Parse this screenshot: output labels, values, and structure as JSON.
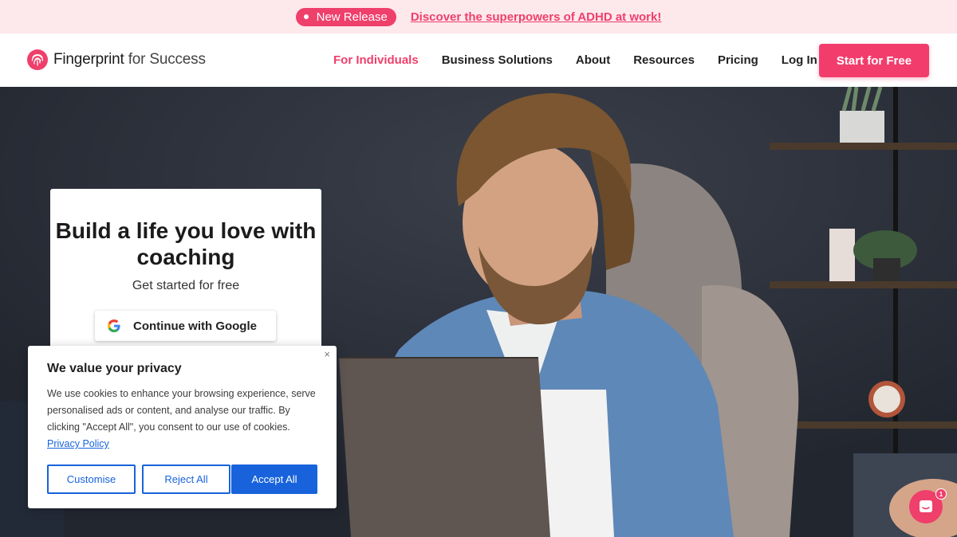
{
  "announcement": {
    "pill_label": "New Release",
    "link_text": "Discover the superpowers of ADHD at work!"
  },
  "header": {
    "logo_brand": "Fingerprint",
    "logo_suffix": " for Success",
    "nav": [
      {
        "label": "For Individuals",
        "active": true
      },
      {
        "label": "Business Solutions",
        "active": false
      },
      {
        "label": "About",
        "active": false
      },
      {
        "label": "Resources",
        "active": false
      },
      {
        "label": "Pricing",
        "active": false
      },
      {
        "label": "Log In",
        "active": false
      }
    ],
    "cta_label": "Start for Free"
  },
  "hero": {
    "title": "Build a life you love with coaching",
    "subtitle": "Get started for free",
    "google_button_label": "Continue with Google"
  },
  "cookie_banner": {
    "close_symbol": "×",
    "title": "We value your privacy",
    "text": "We use cookies to enhance your browsing experience, serve personalised ads or content, and analyse our traffic. By clicking \"Accept All\", you consent to our use of cookies.",
    "policy_link": "Privacy Policy",
    "customise_label": "Customise",
    "reject_label": "Reject All",
    "accept_label": "Accept All"
  },
  "chat": {
    "badge_count": "1"
  },
  "colors": {
    "brand_pink": "#ef3f6b",
    "cookie_blue": "#1863dc",
    "announce_bg": "#fde8ec"
  }
}
